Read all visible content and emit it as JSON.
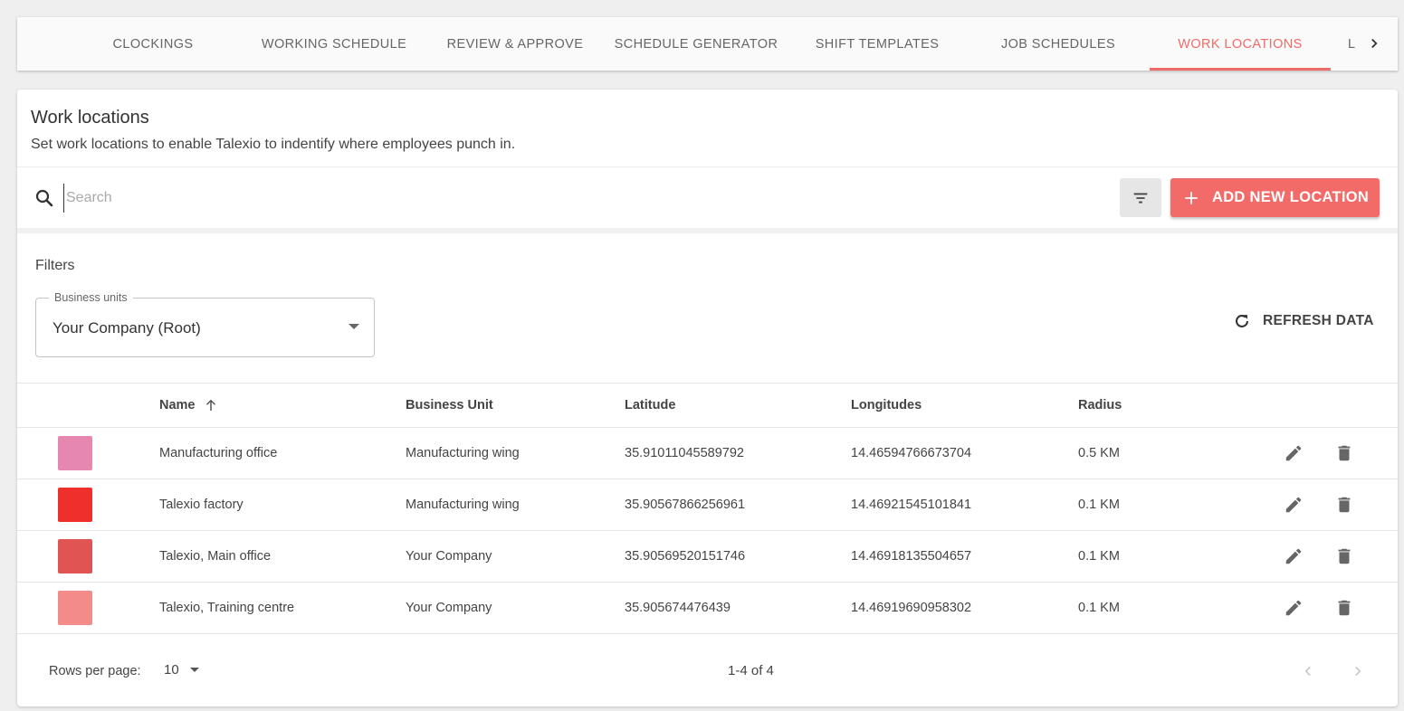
{
  "tabs": [
    {
      "label": "CLOCKINGS",
      "active": false
    },
    {
      "label": "WORKING SCHEDULE",
      "active": false
    },
    {
      "label": "REVIEW & APPROVE",
      "active": false
    },
    {
      "label": "SCHEDULE GENERATOR",
      "active": false
    },
    {
      "label": "SHIFT TEMPLATES",
      "active": false
    },
    {
      "label": "JOB SCHEDULES",
      "active": false
    },
    {
      "label": "WORK LOCATIONS",
      "active": true
    },
    {
      "label": "L",
      "active": false
    }
  ],
  "card": {
    "title": "Work locations",
    "subtitle": "Set work locations to enable Talexio to indentify where employees punch in."
  },
  "search": {
    "placeholder": "Search",
    "value": ""
  },
  "toolbar": {
    "add_label": "ADD NEW LOCATION"
  },
  "filters": {
    "label": "Filters",
    "business_units_legend": "Business units",
    "business_units_value": "Your Company (Root)",
    "refresh_label": "REFRESH DATA"
  },
  "table": {
    "columns": [
      "Name",
      "Business Unit",
      "Latitude",
      "Longitudes",
      "Radius"
    ],
    "sort": {
      "column": "Name",
      "direction": "asc"
    },
    "rows": [
      {
        "color": "#e687b0",
        "name": "Manufacturing office",
        "business_unit": "Manufacturing wing",
        "latitude": "35.91011045589792",
        "longitude": "14.46594766673704",
        "radius": "0.5 KM"
      },
      {
        "color": "#ee2f2c",
        "name": "Talexio factory",
        "business_unit": "Manufacturing wing",
        "latitude": "35.90567866256961",
        "longitude": "14.46921545101841",
        "radius": "0.1 KM"
      },
      {
        "color": "#e05554",
        "name": "Talexio, Main office",
        "business_unit": "Your Company",
        "latitude": "35.90569520151746",
        "longitude": "14.46918135504657",
        "radius": "0.1 KM"
      },
      {
        "color": "#f28b8a",
        "name": "Talexio, Training centre",
        "business_unit": "Your Company",
        "latitude": "35.905674476439",
        "longitude": "14.46919690958302",
        "radius": "0.1 KM"
      }
    ]
  },
  "pagination": {
    "rows_per_page_label": "Rows per page:",
    "rows_per_page": "10",
    "range": "1-4 of 4"
  },
  "colors": {
    "accent": "#f36b68",
    "active_tab": "#ef6b68"
  },
  "icons": [
    "chevron-right-icon",
    "search-icon",
    "filter-list-icon",
    "plus-icon",
    "refresh-icon",
    "arrow-up-icon",
    "edit-icon",
    "delete-icon",
    "chevron-left-icon"
  ]
}
